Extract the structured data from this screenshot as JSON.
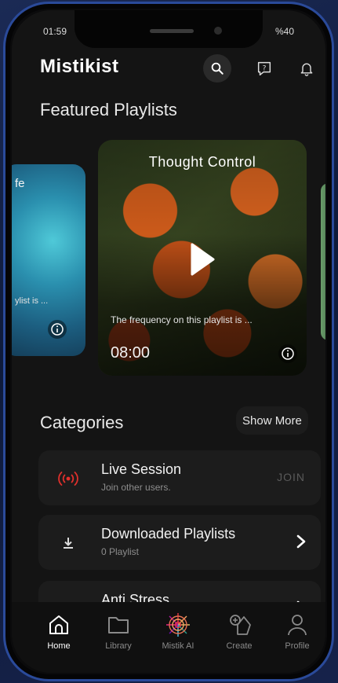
{
  "status": {
    "time": "01:59",
    "right": "%40"
  },
  "app": {
    "title": "Mistikist"
  },
  "featured": {
    "title": "Featured Playlists",
    "left_card": {
      "title": "fe",
      "desc": "ylist is ..."
    },
    "main_card": {
      "title": "Thought Control",
      "desc": "The frequency on this playlist is ...",
      "duration": "08:00"
    }
  },
  "categories": {
    "title": "Categories",
    "show_more": "Show More",
    "items": [
      {
        "name": "Live Session",
        "sub": "Join other users.",
        "action": "JOIN",
        "icon": "live-broadcast-icon",
        "icon_color": "#e0302c"
      },
      {
        "name": "Downloaded Playlists",
        "sub": "0 Playlist",
        "icon": "download-icon"
      },
      {
        "name": "Anti Stress",
        "sub": "",
        "icon": "leaf-icon"
      }
    ]
  },
  "nav": [
    {
      "label": "Home",
      "icon": "home-icon",
      "active": true
    },
    {
      "label": "Library",
      "icon": "folder-icon"
    },
    {
      "label": "Mistik AI",
      "icon": "mistik-ai-icon"
    },
    {
      "label": "Create",
      "icon": "create-icon"
    },
    {
      "label": "Profile",
      "icon": "profile-icon"
    }
  ]
}
